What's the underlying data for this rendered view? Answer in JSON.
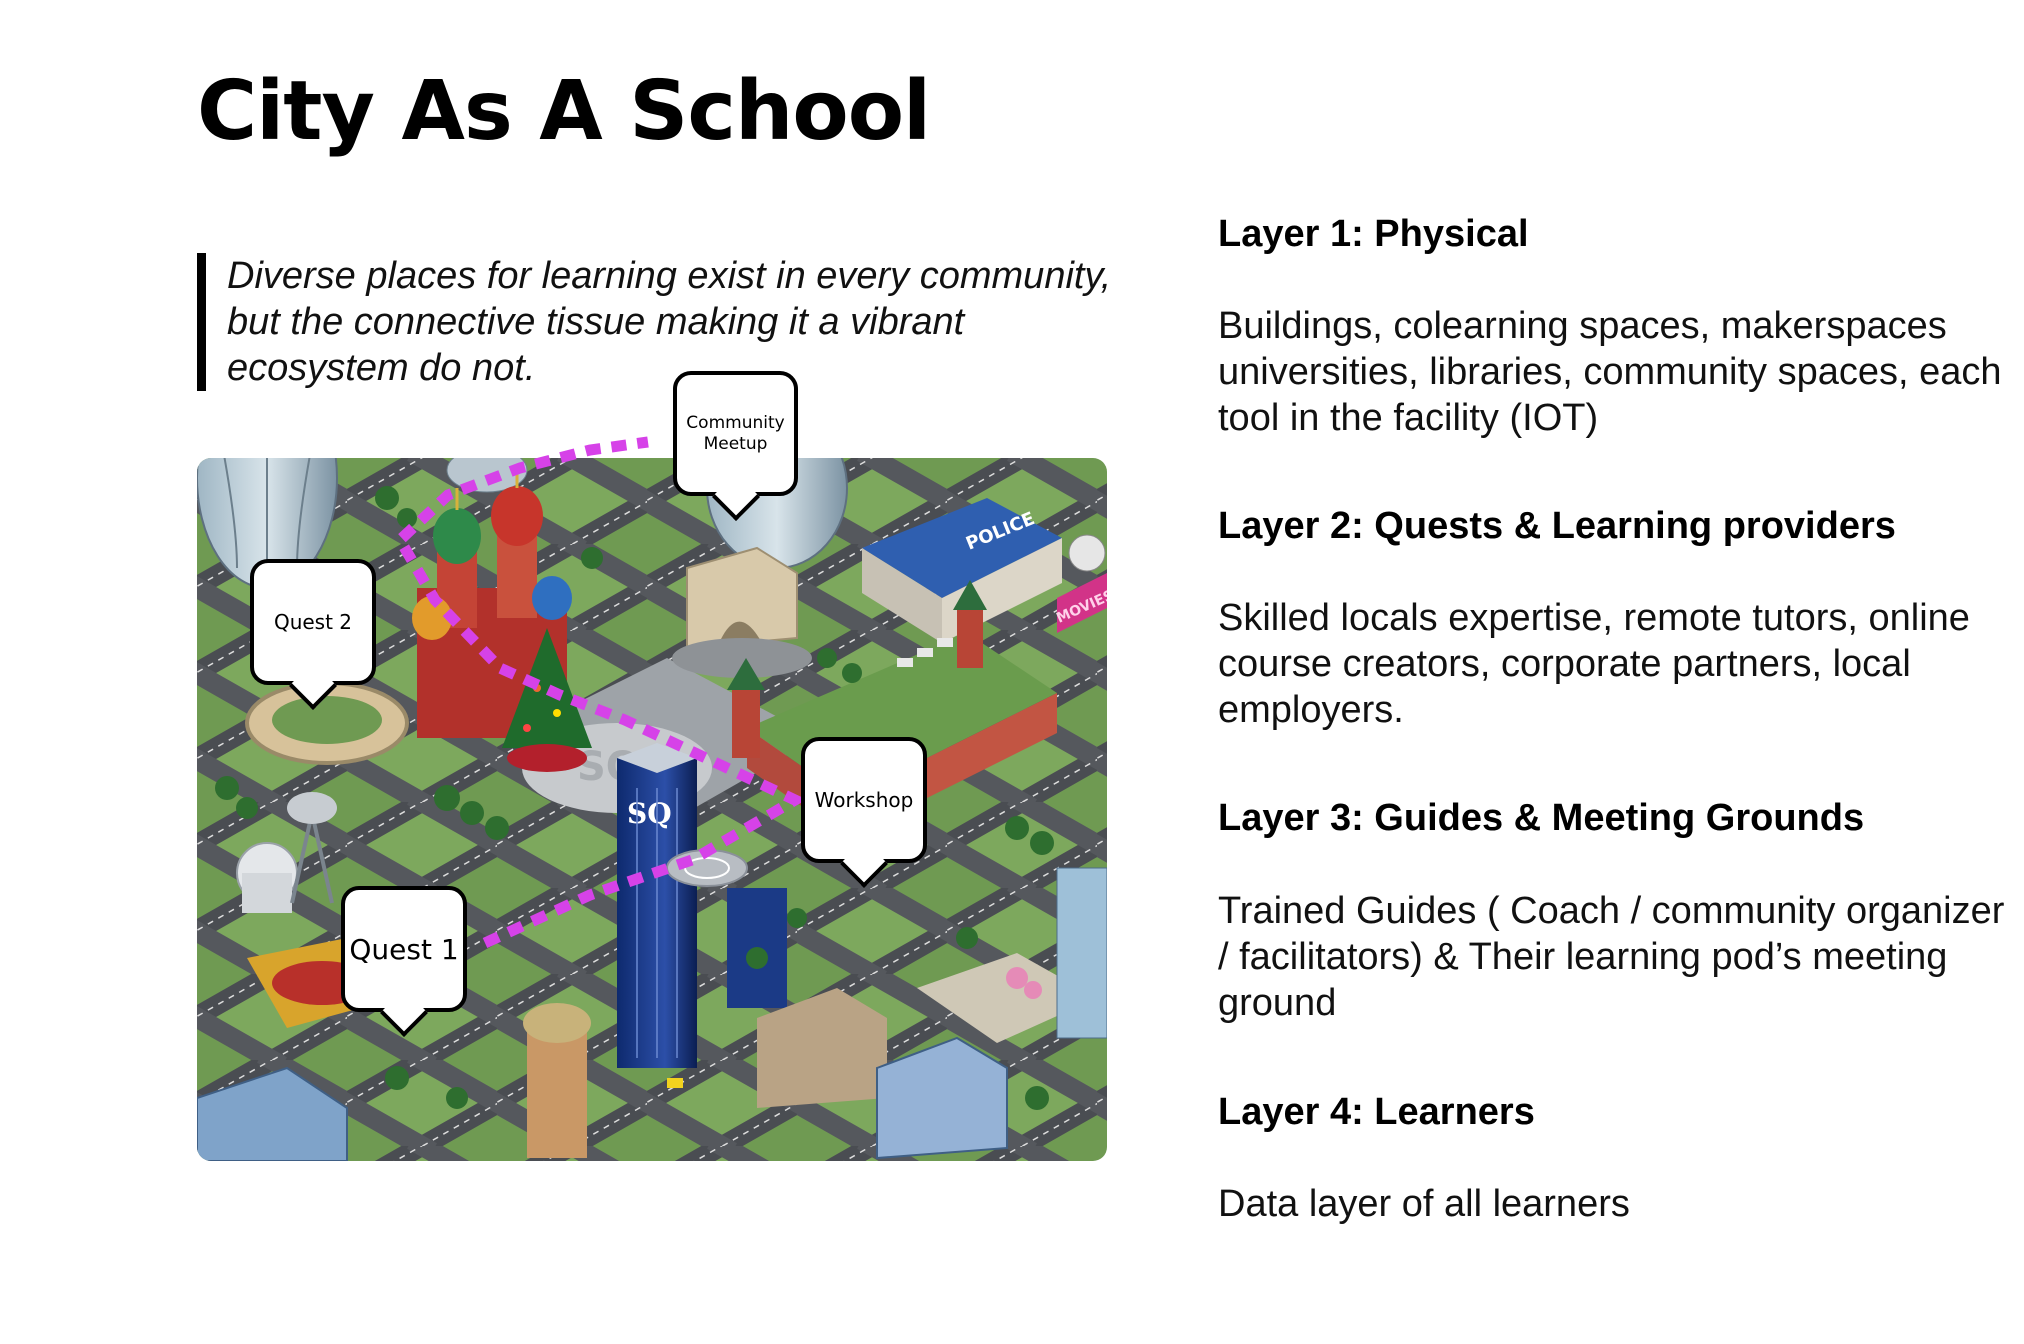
{
  "slide": {
    "title": "City As A School",
    "quote": "Diverse places for learning exist in every community, but the connective tissue making it a vibrant ecosystem do not."
  },
  "map": {
    "pins": [
      {
        "label": "Community Meetup"
      },
      {
        "label": "Quest 2"
      },
      {
        "label": "Workshop"
      },
      {
        "label": "Quest 1"
      }
    ],
    "signage": {
      "police": "POLICE",
      "movies": "MOVIES",
      "tower": "SQ"
    },
    "path_color": "#d642e8"
  },
  "layers": [
    {
      "heading": "Layer 1: Physical",
      "description": "Buildings, colearning spaces, makerspaces universities, libraries, community spaces, each tool in the facility (IOT)"
    },
    {
      "heading": "Layer 2: Quests & Learning providers",
      "description": "Skilled locals expertise, remote tutors, online course creators, corporate partners, local employers."
    },
    {
      "heading": "Layer 3: Guides & Meeting Grounds",
      "description": "Trained Guides ( Coach / community organizer / facilitators) & Their learning pod’s meeting ground"
    },
    {
      "heading": "Layer 4: Learners",
      "description": "Data layer of all learners"
    }
  ]
}
